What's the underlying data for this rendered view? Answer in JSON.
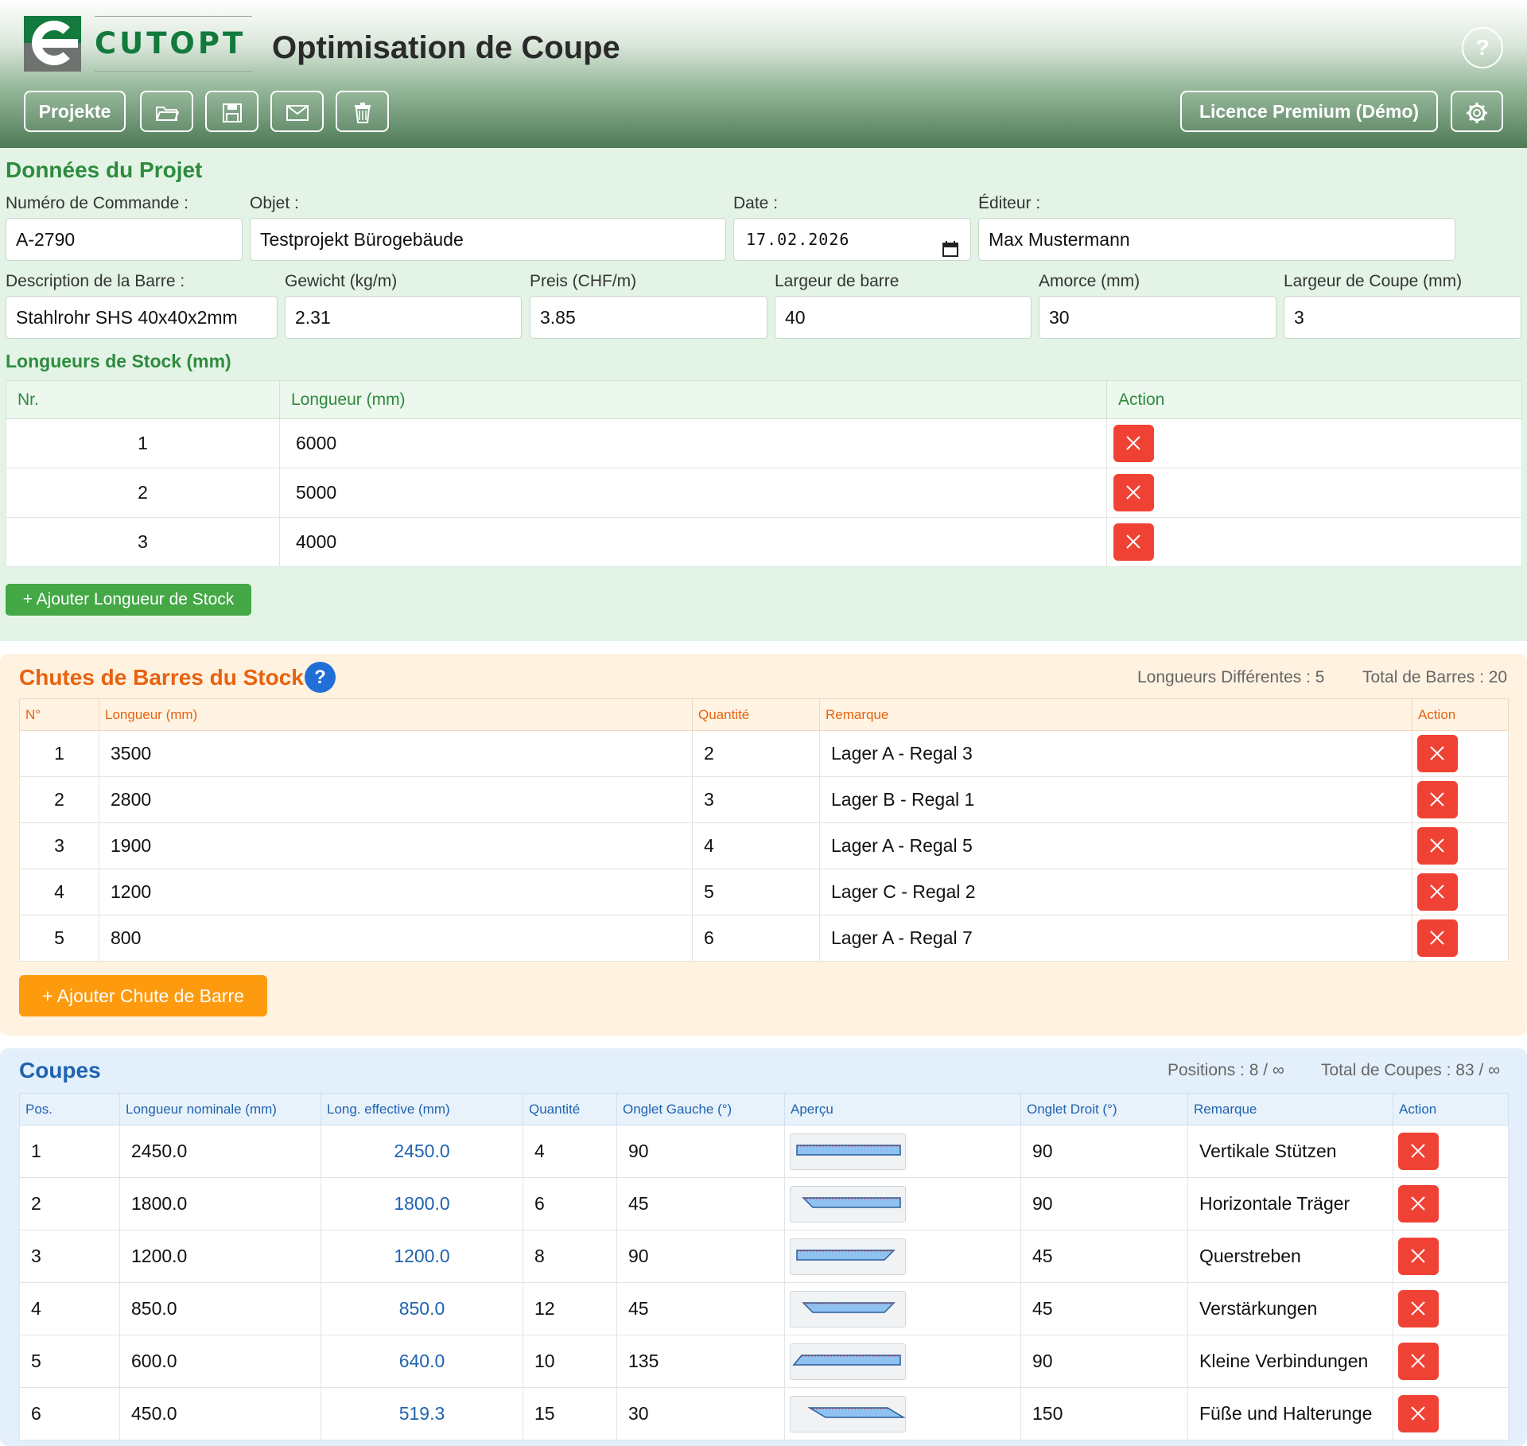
{
  "header": {
    "brand": "CUTOPT",
    "title": "Optimisation de Coupe",
    "help": "?",
    "projects_label": "Projekte",
    "license_label": "Licence Premium (Démo)",
    "toolbar_icons": [
      "folder-icon",
      "save-icon",
      "mail-icon",
      "trash-icon"
    ],
    "settings_icon": "gear-icon",
    "colors": {
      "brand_green": "#127a3d",
      "header_dark": "#4e7a55"
    }
  },
  "project": {
    "title": "Données du Projet",
    "fields": {
      "order_number": {
        "label": "Numéro de Commande :",
        "value": "A-2790"
      },
      "object": {
        "label": "Objet :",
        "value": "Testprojekt Bürogebäude"
      },
      "date": {
        "label": "Date :",
        "value": "17.02.2026"
      },
      "editor": {
        "label": "Éditeur :",
        "value": "Max Mustermann"
      },
      "bar_description": {
        "label": "Description de la Barre :",
        "value": "Stahlrohr SHS 40x40x2mm"
      },
      "weight": {
        "label": "Gewicht (kg/m)",
        "value": "2.31"
      },
      "price": {
        "label": "Preis (CHF/m)",
        "value": "3.85"
      },
      "bar_width": {
        "label": "Largeur de barre",
        "value": "40"
      },
      "lead": {
        "label": "Amorce (mm)",
        "value": "30"
      },
      "cut_width": {
        "label": "Largeur de Coupe (mm)",
        "value": "3"
      }
    },
    "stock": {
      "title": "Longueurs de Stock (mm)",
      "columns": [
        "Nr.",
        "Longueur (mm)",
        "Action"
      ],
      "rows": [
        {
          "nr": "1",
          "length": "6000"
        },
        {
          "nr": "2",
          "length": "5000"
        },
        {
          "nr": "3",
          "length": "4000"
        }
      ],
      "add_label": "+ Ajouter Longueur de Stock"
    }
  },
  "chutes": {
    "title": "Chutes de Barres du Stock",
    "help": "?",
    "stat_lengths": "Longueurs Différentes : 5",
    "stat_total": "Total de Barres : 20",
    "columns": [
      "N°",
      "Longueur (mm)",
      "Quantité",
      "Remarque",
      "Action"
    ],
    "rows": [
      {
        "n": "1",
        "length": "3500",
        "qty": "2",
        "note": "Lager A - Regal 3"
      },
      {
        "n": "2",
        "length": "2800",
        "qty": "3",
        "note": "Lager B - Regal 1"
      },
      {
        "n": "3",
        "length": "1900",
        "qty": "4",
        "note": "Lager A - Regal 5"
      },
      {
        "n": "4",
        "length": "1200",
        "qty": "5",
        "note": "Lager C - Regal 2"
      },
      {
        "n": "5",
        "length": "800",
        "qty": "6",
        "note": "Lager A - Regal 7"
      }
    ],
    "add_label": "+ Ajouter Chute de Barre",
    "accent_color": "#e8620e"
  },
  "coupes": {
    "title": "Coupes",
    "stat_positions": "Positions : 8 / ∞",
    "stat_total": "Total de Coupes : 83 / ∞",
    "columns": [
      "Pos.",
      "Longueur nominale (mm)",
      "Long. effective (mm)",
      "Quantité",
      "Onglet Gauche (°)",
      "Aperçu",
      "Onglet Droit (°)",
      "Remarque",
      "Action"
    ],
    "rows": [
      {
        "pos": "1",
        "nominal": "2450.0",
        "effective": "2450.0",
        "qty": "4",
        "left": "90",
        "right": "90",
        "note": "Vertikale Stützen"
      },
      {
        "pos": "2",
        "nominal": "1800.0",
        "effective": "1800.0",
        "qty": "6",
        "left": "45",
        "right": "90",
        "note": "Horizontale Träger"
      },
      {
        "pos": "3",
        "nominal": "1200.0",
        "effective": "1200.0",
        "qty": "8",
        "left": "90",
        "right": "45",
        "note": "Querstreben"
      },
      {
        "pos": "4",
        "nominal": "850.0",
        "effective": "850.0",
        "qty": "12",
        "left": "45",
        "right": "45",
        "note": "Verstärkungen"
      },
      {
        "pos": "5",
        "nominal": "600.0",
        "effective": "640.0",
        "qty": "10",
        "left": "135",
        "right": "90",
        "note": "Kleine Verbindungen"
      },
      {
        "pos": "6",
        "nominal": "450.0",
        "effective": "519.3",
        "qty": "15",
        "left": "30",
        "right": "150",
        "note": "Füße und Halterunge"
      }
    ],
    "accent_color": "#1f63b0"
  }
}
